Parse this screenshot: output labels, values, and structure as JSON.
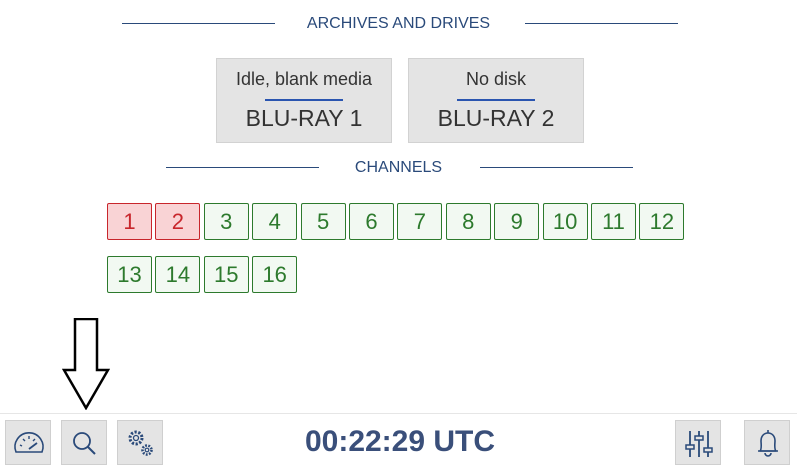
{
  "archives": {
    "title": "ARCHIVES AND DRIVES",
    "drives": [
      {
        "status": "Idle, blank media",
        "name": "BLU-RAY 1"
      },
      {
        "status": "No disk",
        "name": "BLU-RAY 2"
      }
    ]
  },
  "channels": {
    "title": "CHANNELS",
    "items": [
      {
        "label": "1",
        "state": "alert"
      },
      {
        "label": "2",
        "state": "alert"
      },
      {
        "label": "3",
        "state": "ok"
      },
      {
        "label": "4",
        "state": "ok"
      },
      {
        "label": "5",
        "state": "ok"
      },
      {
        "label": "6",
        "state": "ok"
      },
      {
        "label": "7",
        "state": "ok"
      },
      {
        "label": "8",
        "state": "ok"
      },
      {
        "label": "9",
        "state": "ok"
      },
      {
        "label": "10",
        "state": "ok"
      },
      {
        "label": "11",
        "state": "ok"
      },
      {
        "label": "12",
        "state": "ok"
      },
      {
        "label": "13",
        "state": "ok"
      },
      {
        "label": "14",
        "state": "ok"
      },
      {
        "label": "15",
        "state": "ok"
      },
      {
        "label": "16",
        "state": "ok"
      }
    ]
  },
  "footer": {
    "clock": "00:22:29 UTC",
    "icons": [
      "dashboard-gauge-icon",
      "search-icon",
      "settings-gears-icon",
      "mixer-sliders-icon",
      "bell-icon"
    ]
  },
  "colors": {
    "accent": "#2a4a7a",
    "ok_green": "#2d7a2d",
    "alert_red": "#c8262c",
    "alert_bg": "#f9d3d5",
    "button_bg": "#e4e4e4"
  }
}
